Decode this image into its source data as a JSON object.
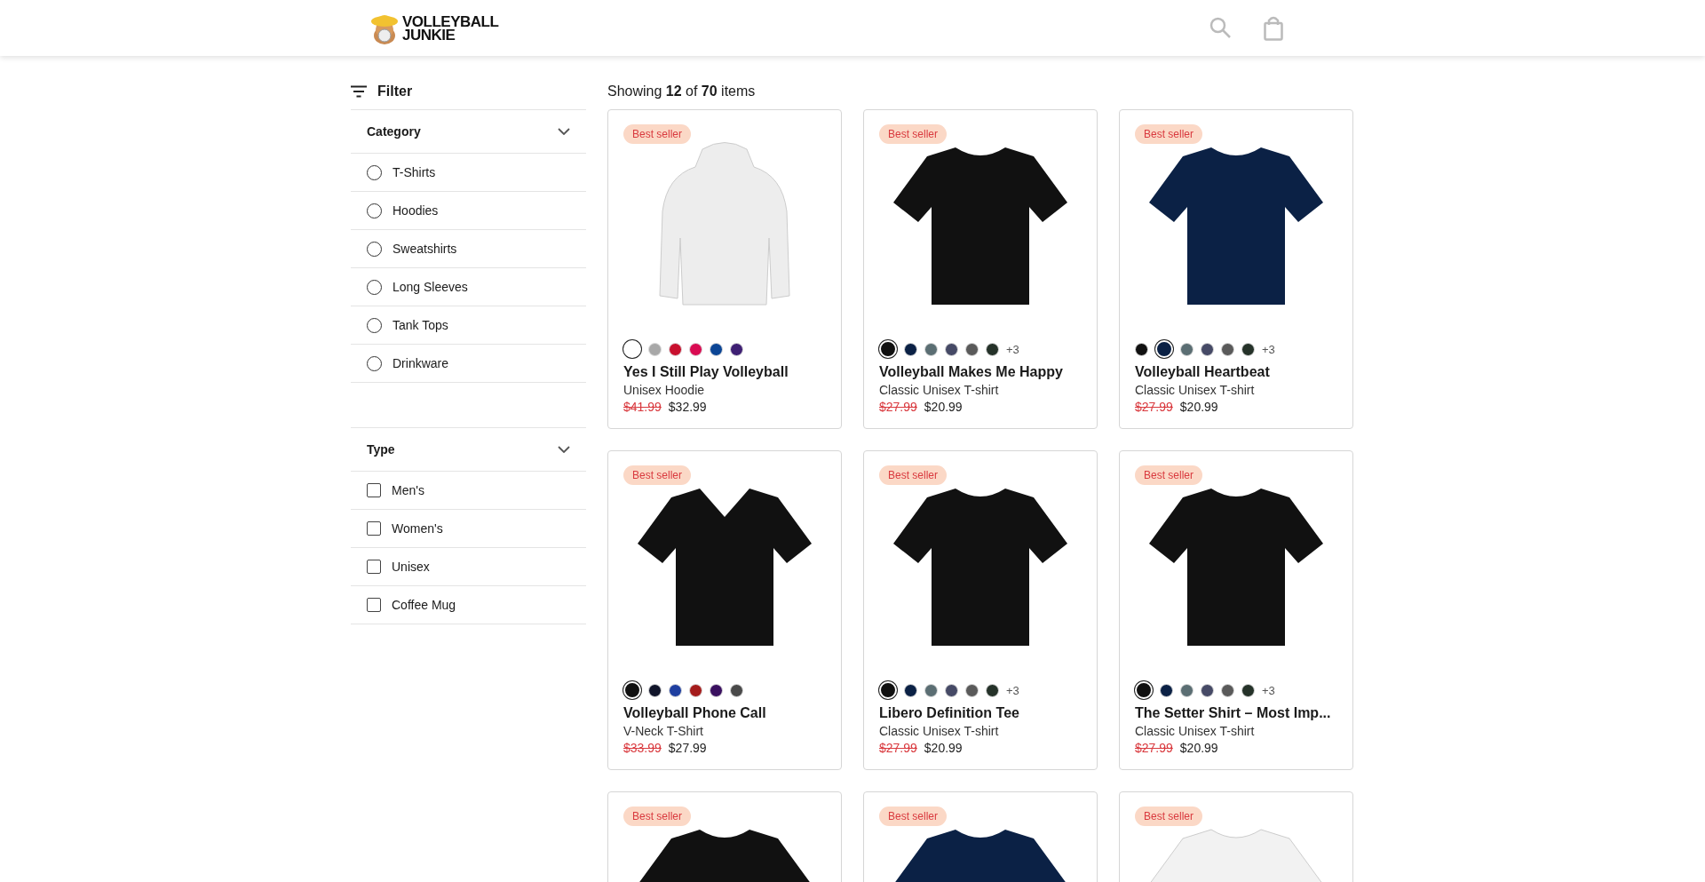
{
  "header": {
    "logo_lines": [
      "VOLLEYBALL",
      "JUNKIE"
    ]
  },
  "filter": {
    "title": "Filter",
    "sections": [
      {
        "title": "Category",
        "kind": "radio",
        "expanded": true,
        "options": [
          {
            "label": "T-Shirts",
            "selected": false
          },
          {
            "label": "Hoodies",
            "selected": false
          },
          {
            "label": "Sweatshirts",
            "selected": false
          },
          {
            "label": "Long Sleeves",
            "selected": false
          },
          {
            "label": "Tank Tops",
            "selected": false
          },
          {
            "label": "Drinkware",
            "selected": false
          }
        ]
      },
      {
        "title": "Type",
        "kind": "checkbox",
        "expanded": true,
        "options": [
          {
            "label": "Men's",
            "checked": false
          },
          {
            "label": "Women's",
            "checked": false
          },
          {
            "label": "Unisex",
            "checked": false
          },
          {
            "label": "Coffee Mug",
            "checked": false
          }
        ]
      }
    ]
  },
  "summary": "Showing **12** of **70** items",
  "products": [
    {
      "kind": "hoodie",
      "badge": "Best seller",
      "swatches": [
        {
          "color": "#ffffff",
          "selected": true
        },
        {
          "color": "#a8a8a8",
          "selected": false
        },
        {
          "color": "#c8102e",
          "selected": false
        },
        {
          "color": "#d90b52",
          "selected": false
        },
        {
          "color": "#0b4595",
          "selected": false
        },
        {
          "color": "#3e1f73",
          "selected": false
        }
      ],
      "title": "Yes I Still Play Volleyball",
      "subtitle": "Unisex Hoodie",
      "old_price": "$41.99",
      "price": "$32.99"
    },
    {
      "kind": "tshirt",
      "badge": "Best seller",
      "swatches": [
        {
          "color": "#111111",
          "selected": true
        },
        {
          "color": "#0b2145",
          "selected": false
        },
        {
          "color": "#5b6e73",
          "selected": false
        },
        {
          "color": "#464a66",
          "selected": false
        },
        {
          "color": "#5a5a5a",
          "selected": false
        },
        {
          "color": "#253229",
          "selected": false
        }
      ],
      "more": "+3",
      "title": "Volleyball Makes Me Happy",
      "subtitle": "Classic Unisex T-shirt",
      "old_price": "$27.99",
      "price": "$20.99"
    },
    {
      "kind": "tshirt",
      "badge": "Best seller",
      "swatches": [
        {
          "color": "#111111",
          "selected": false
        },
        {
          "color": "#0b2145",
          "selected": true
        },
        {
          "color": "#5b6e73",
          "selected": false
        },
        {
          "color": "#464a66",
          "selected": false
        },
        {
          "color": "#5a5a5a",
          "selected": false
        },
        {
          "color": "#253229",
          "selected": false
        }
      ],
      "more": "+3",
      "title": "Volleyball Heartbeat",
      "subtitle": "Classic Unisex T-shirt",
      "old_price": "$27.99",
      "price": "$20.99"
    },
    {
      "kind": "vneck",
      "badge": "Best seller",
      "swatches": [
        {
          "color": "#111111",
          "selected": true
        },
        {
          "color": "#11152a",
          "selected": false
        },
        {
          "color": "#1f3fa0",
          "selected": false
        },
        {
          "color": "#a51c1c",
          "selected": false
        },
        {
          "color": "#3a1060",
          "selected": false
        },
        {
          "color": "#4a4a4a",
          "selected": false
        }
      ],
      "title": "Volleyball Phone Call",
      "subtitle": "V-Neck T-Shirt",
      "old_price": "$33.99",
      "price": "$27.99"
    },
    {
      "kind": "tshirt",
      "badge": "Best seller",
      "swatches": [
        {
          "color": "#111111",
          "selected": true
        },
        {
          "color": "#0b2145",
          "selected": false
        },
        {
          "color": "#5b6e73",
          "selected": false
        },
        {
          "color": "#464a66",
          "selected": false
        },
        {
          "color": "#5a5a5a",
          "selected": false
        },
        {
          "color": "#253229",
          "selected": false
        }
      ],
      "more": "+3",
      "title": "Libero Definition Tee",
      "subtitle": "Classic Unisex T-shirt",
      "old_price": "$27.99",
      "price": "$20.99"
    },
    {
      "kind": "tshirt",
      "badge": "Best seller",
      "swatches": [
        {
          "color": "#111111",
          "selected": true
        },
        {
          "color": "#0b2145",
          "selected": false
        },
        {
          "color": "#5b6e73",
          "selected": false
        },
        {
          "color": "#464a66",
          "selected": false
        },
        {
          "color": "#5a5a5a",
          "selected": false
        },
        {
          "color": "#253229",
          "selected": false
        }
      ],
      "more": "+3",
      "title": "The Setter Shirt – Most Imp...",
      "subtitle": "Classic Unisex T-shirt",
      "old_price": "$27.99",
      "price": "$20.99"
    },
    {
      "kind": "tshirt",
      "badge": "Best seller",
      "color": "#111111"
    },
    {
      "kind": "tshirt",
      "badge": "Best seller",
      "color": "#0b2145"
    },
    {
      "kind": "tshirt",
      "badge": "Best seller",
      "color": "#f2f2f2"
    }
  ]
}
